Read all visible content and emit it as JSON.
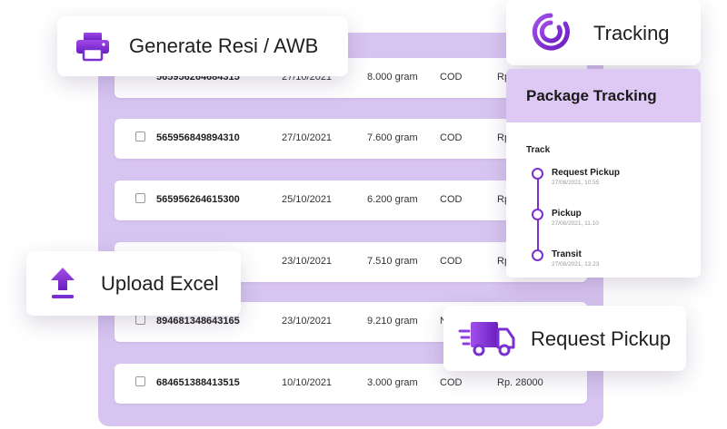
{
  "colors": {
    "accent": "#7a2fd1",
    "panel": "#d8c4f0",
    "header": "#ddc9f4"
  },
  "table": {
    "rows": [
      {
        "id": "565956264684315",
        "date": "27/10/2021",
        "weight": "8.000 gram",
        "payment": "COD",
        "price": "Rp"
      },
      {
        "id": "565956849894310",
        "date": "27/10/2021",
        "weight": "7.600 gram",
        "payment": "COD",
        "price": "Rp"
      },
      {
        "id": "565956264615300",
        "date": "25/10/2021",
        "weight": "6.200 gram",
        "payment": "COD",
        "price": "Rp"
      },
      {
        "id": "",
        "date": "23/10/2021",
        "weight": "7.510 gram",
        "payment": "COD",
        "price": "Rp"
      },
      {
        "id": "894681348643165",
        "date": "23/10/2021",
        "weight": "9.210 gram",
        "payment": "N",
        "price": ""
      },
      {
        "id": "684651388413515",
        "date": "10/10/2021",
        "weight": "3.000 gram",
        "payment": "COD",
        "price": "Rp. 28000"
      }
    ]
  },
  "features": {
    "generate": {
      "label": "Generate Resi / AWB",
      "icon": "printer-icon"
    },
    "tracking": {
      "label": "Tracking",
      "icon": "target-icon"
    },
    "upload": {
      "label": "Upload Excel",
      "icon": "upload-icon"
    },
    "pickup": {
      "label": "Request Pickup",
      "icon": "truck-icon"
    }
  },
  "tracking_panel": {
    "title": "Package Tracking",
    "section": "Track",
    "steps": [
      {
        "title": "Request Pickup",
        "time": "27/08/2021, 10.55"
      },
      {
        "title": "Pickup",
        "time": "27/08/2021, 11.10"
      },
      {
        "title": "Transit",
        "time": "27/08/2021, 13.23"
      }
    ]
  }
}
